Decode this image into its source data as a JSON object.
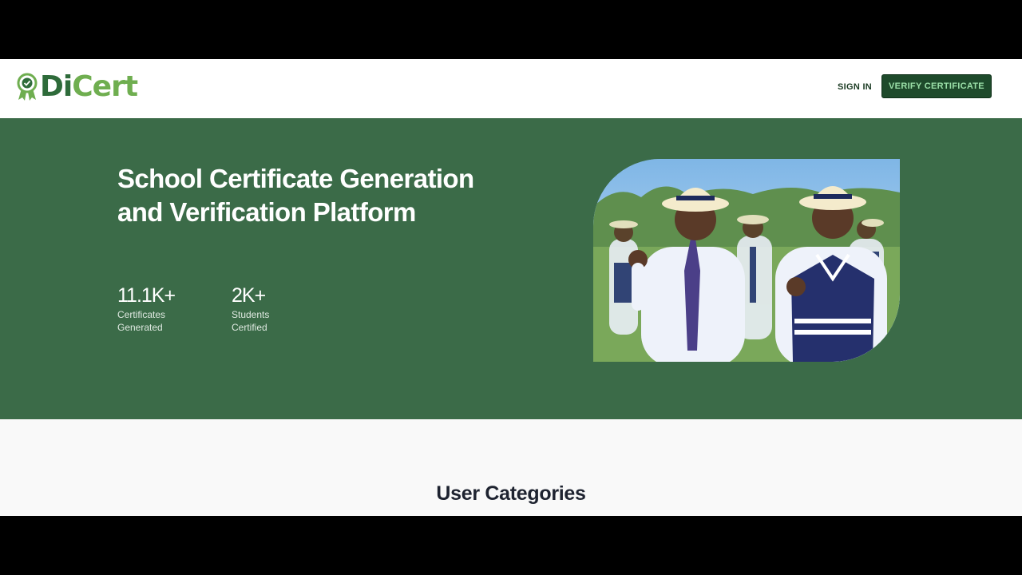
{
  "header": {
    "logo_prefix": "Di",
    "logo_suffix": "Cert",
    "signin_label": "SIGN IN",
    "verify_label": "VERIFY CERTIFICATE"
  },
  "hero": {
    "title": "School Certificate Generation and Verification Platform",
    "stats": [
      {
        "value": "11.1K+",
        "label_line1": "Certificates",
        "label_line2": "Generated"
      },
      {
        "value": "2K+",
        "label_line1": "Students",
        "label_line2": "Certified"
      }
    ]
  },
  "sections": {
    "user_categories_title": "User Categories"
  },
  "colors": {
    "hero_bg": "#3b6b48",
    "button_bg": "#1e4a2b",
    "logo_dark": "#2e6b3a",
    "logo_light": "#6fae50"
  },
  "icons": {
    "logo": "award-badge-icon"
  }
}
